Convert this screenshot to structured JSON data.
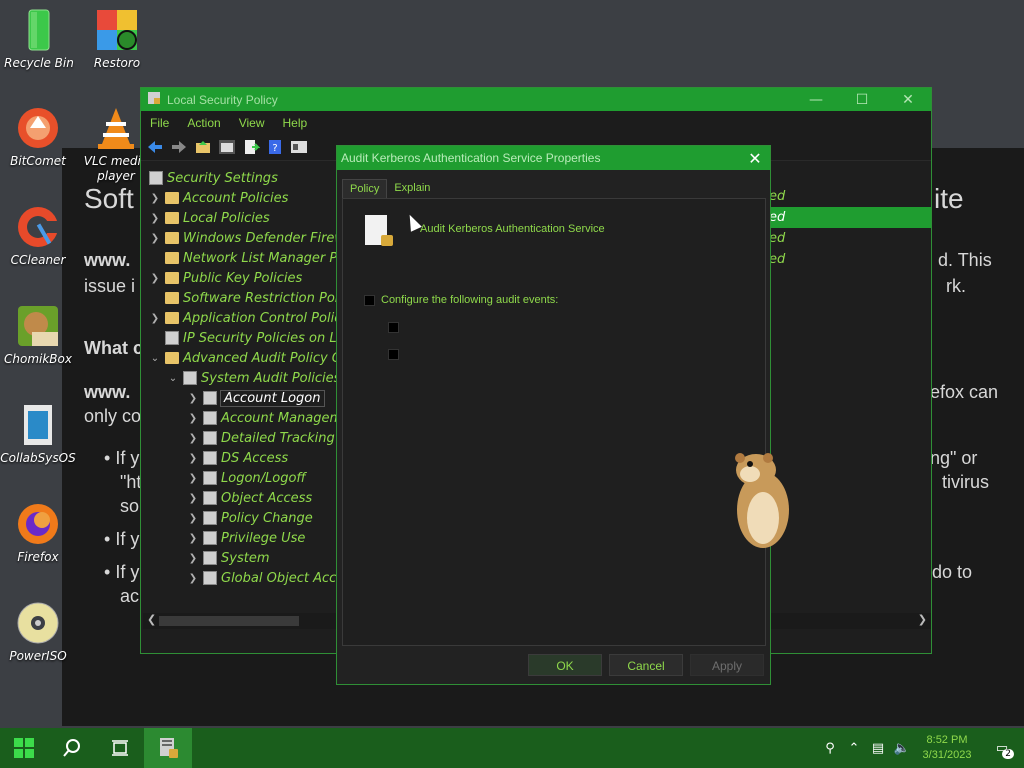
{
  "desktop": {
    "icons": [
      {
        "label": "Recycle Bin"
      },
      {
        "label": "Restoro"
      },
      {
        "label": "BitComet"
      },
      {
        "label": "VLC media player"
      },
      {
        "label": "CCleaner"
      },
      {
        "label": "ChomikBox"
      },
      {
        "label": "CollabSysOS"
      },
      {
        "label": "Firefox"
      },
      {
        "label": "PowerISO"
      }
    ]
  },
  "background_page": {
    "heading_start": "Soft",
    "heading_end": "ite",
    "line1_start": "www.",
    "line1_end": "d. This",
    "line2_start": "issue i",
    "line2_end": "rk.",
    "subheading": "What c",
    "line3_start": "www.",
    "line3_end": "efox can",
    "line4": "only co",
    "bullet1_start": "If y",
    "bullet1_end": "ng\" or",
    "bullet1b": "\"ht",
    "bullet1b_end": "tivirus",
    "bullet1c": "so",
    "bullet2": "If y",
    "bullet3_start": "If y",
    "bullet3_end": "do to",
    "bullet3b": "ac"
  },
  "lsp_window": {
    "title": "Local Security Policy",
    "menu": [
      "File",
      "Action",
      "View",
      "Help"
    ],
    "tree": [
      {
        "label": "Security Settings"
      },
      {
        "label": "Account Policies"
      },
      {
        "label": "Local Policies"
      },
      {
        "label": "Windows Defender Firew"
      },
      {
        "label": "Network List Manager Po"
      },
      {
        "label": "Public Key Policies"
      },
      {
        "label": "Software Restriction Polic"
      },
      {
        "label": "Application Control Polic"
      },
      {
        "label": "IP Security Policies on Lo"
      },
      {
        "label": "Advanced Audit Policy Co"
      },
      {
        "label": "System Audit Policies"
      },
      {
        "label": "Account Logon"
      },
      {
        "label": "Account Manageme"
      },
      {
        "label": "Detailed Tracking"
      },
      {
        "label": "DS Access"
      },
      {
        "label": "Logon/Logoff"
      },
      {
        "label": "Object Access"
      },
      {
        "label": "Policy Change"
      },
      {
        "label": "Privilege Use"
      },
      {
        "label": "System"
      },
      {
        "label": "Global Object Acce"
      }
    ],
    "right_column": [
      "ed",
      "ed",
      "ed",
      "ed"
    ]
  },
  "dialog": {
    "title": "Audit Kerberos Authentication Service Properties",
    "tabs": [
      "Policy",
      "Explain"
    ],
    "policy_name": "Audit Kerberos Authentication Service",
    "configure_label": "Configure the following audit events:",
    "buttons": {
      "ok": "OK",
      "cancel": "Cancel",
      "apply": "Apply"
    }
  },
  "taskbar": {
    "time": "8:52 PM",
    "date": "3/31/2023",
    "notification_count": "2"
  },
  "colors": {
    "accent": "#1f9d30",
    "text_green": "#8fd94b",
    "taskbar": "#1a5e1c"
  }
}
